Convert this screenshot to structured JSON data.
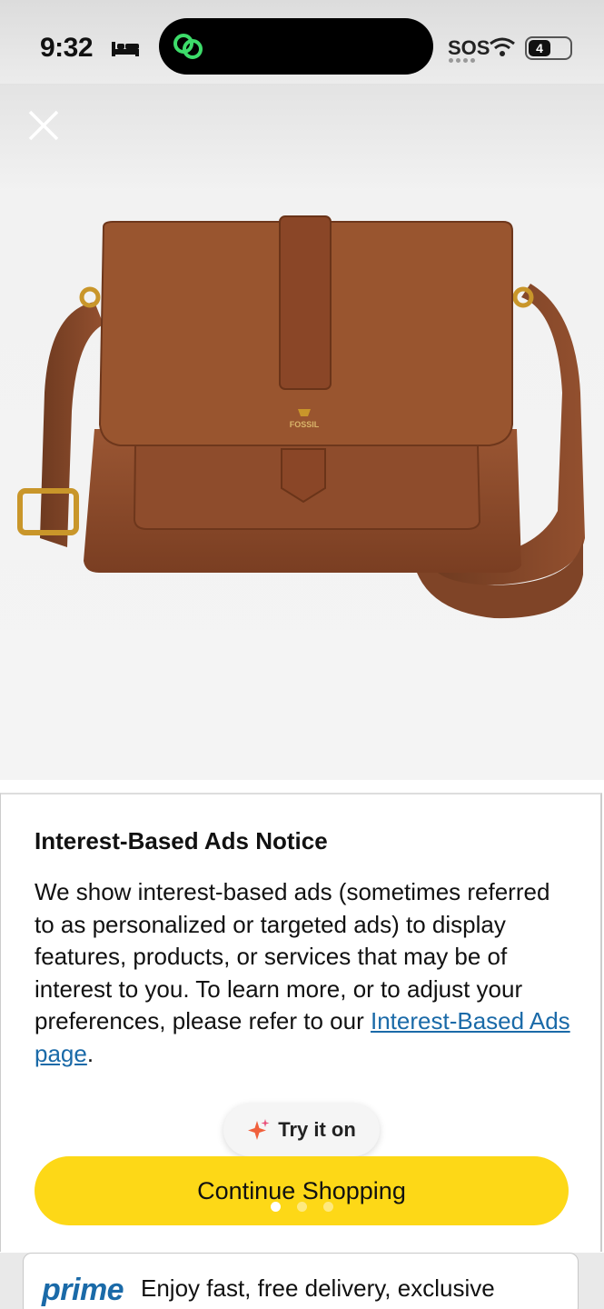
{
  "status_bar": {
    "time": "9:32",
    "carrier": "SOS",
    "battery": "4"
  },
  "notice": {
    "title": "Interest-Based Ads Notice",
    "body": "We show interest-based ads (sometimes referred to as personalized or targeted ads) to display features, products, or services that may be of interest to you. To learn more, or to adjust your preferences, please refer to our ",
    "link_text": "Interest-Based Ads page",
    "suffix": "."
  },
  "try_it_on": {
    "label": "Try it on",
    "icon": "sparkle-icon"
  },
  "continue_button": {
    "label": "Continue Shopping"
  },
  "carousel": {
    "pages": 3,
    "active": 1
  },
  "prime_banner": {
    "logo": "prime",
    "text": "Enjoy fast, free delivery, exclusive"
  },
  "product_image": {
    "brand_mark": "FOSSIL"
  },
  "colors": {
    "accent_yellow": "#fdd817",
    "link_blue": "#1a6aa8",
    "leather_brown": "#8a4a2b"
  }
}
